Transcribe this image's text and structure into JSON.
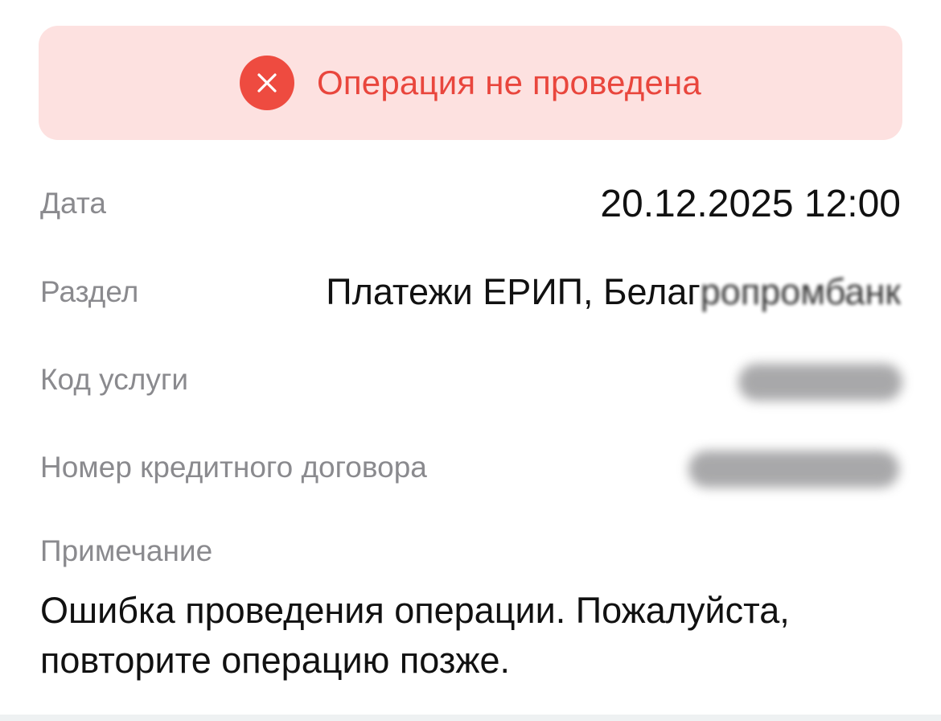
{
  "status": {
    "icon": "close-circle-icon",
    "text": "Операция не проведена",
    "accent_color": "#ee4b40",
    "background_color": "#fde1e0"
  },
  "details": {
    "date": {
      "label": "Дата",
      "value": "20.12.2025 12:00"
    },
    "section": {
      "label": "Раздел",
      "value_main": "Платежи ЕРИП, Белаг",
      "value_blurred": "ропромбанк"
    },
    "service_code": {
      "label": "Код услуги"
    },
    "contract_number": {
      "label": "Номер кредитного договора"
    },
    "note": {
      "label": "Примечание",
      "text": "Ошибка проведения операции. Пожалуйста, повторите операцию позже."
    }
  }
}
